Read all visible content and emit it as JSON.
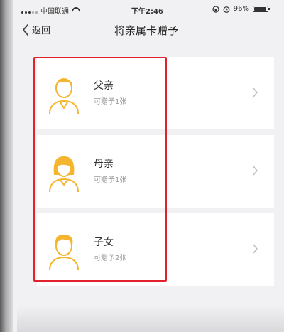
{
  "status_bar": {
    "carrier": "中国联通",
    "time": "下午2:46",
    "battery": "96%",
    "battery_level": 0.96
  },
  "nav": {
    "back_label": "返回",
    "title": "将亲属卡赠予"
  },
  "items": [
    {
      "name": "父亲",
      "sub": "可赠予1张",
      "avatar_icon": "father-avatar-icon"
    },
    {
      "name": "母亲",
      "sub": "可赠予1张",
      "avatar_icon": "mother-avatar-icon"
    },
    {
      "name": "子女",
      "sub": "可赠予2张",
      "avatar_icon": "child-avatar-icon"
    }
  ],
  "colors": {
    "accent": "#f5b52e",
    "highlight": "#e2212c",
    "background": "#f1f1f3"
  }
}
